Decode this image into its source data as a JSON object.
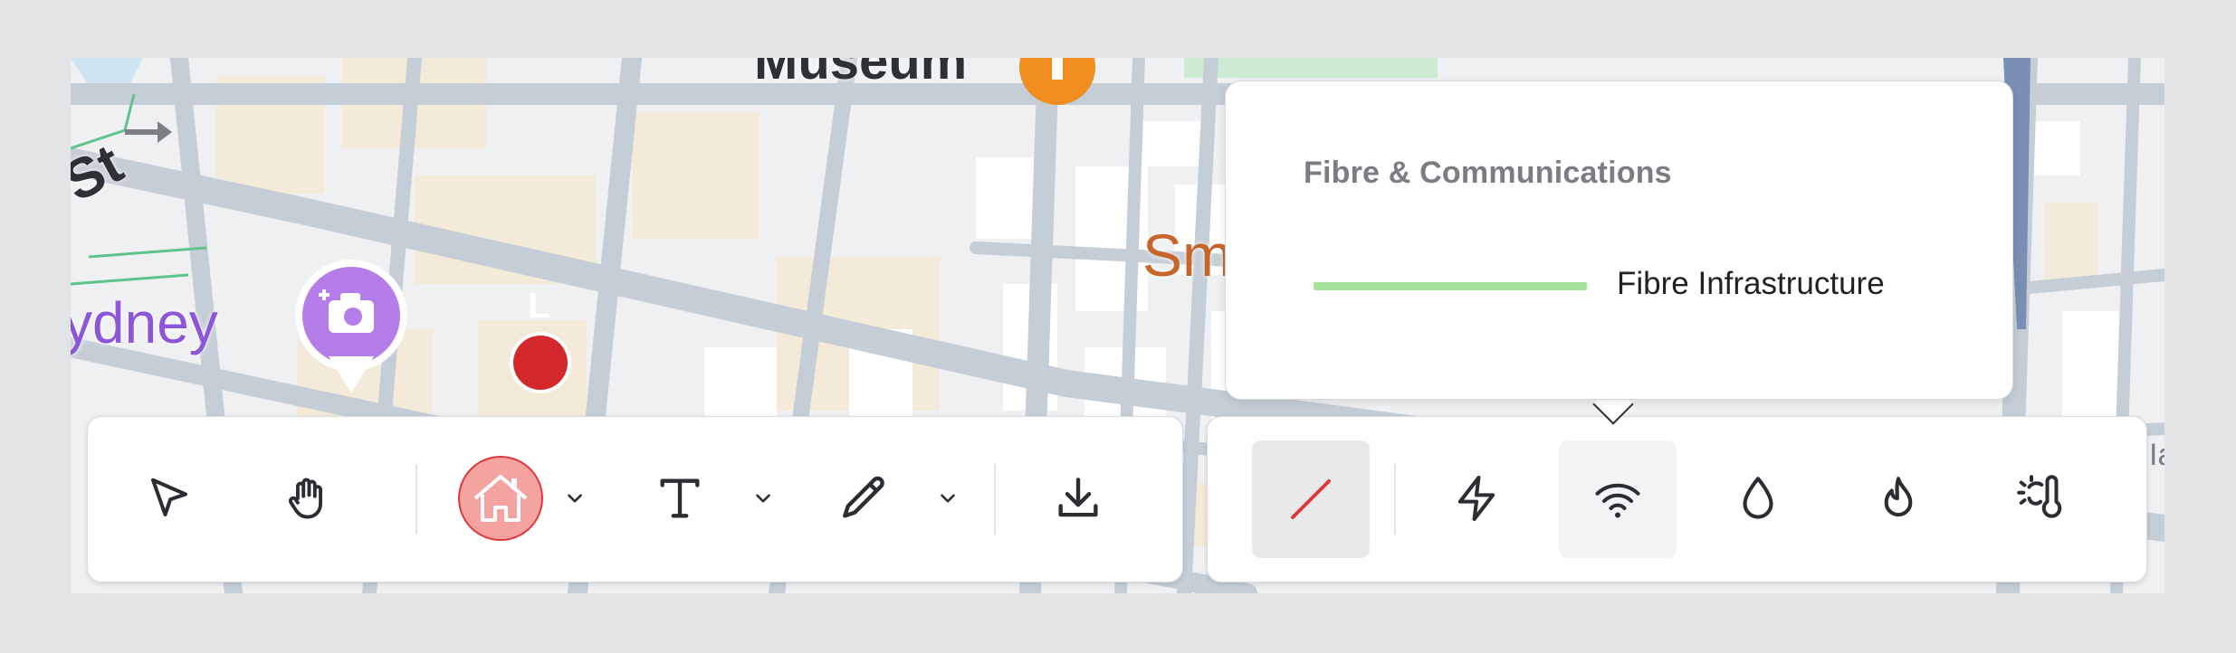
{
  "map": {
    "labels": {
      "street_fragment": "St",
      "place_fragment": "ydney",
      "museum_fragment": "Museum",
      "orange_fragment": "Sm",
      "marker_letter": "L",
      "bottom_fragment": "Ia"
    },
    "colors": {
      "road": "#c5cdd6",
      "block": "#f3ead9",
      "park": "#cdebd3",
      "purple_label": "#8c56d9",
      "orange_label": "#c7662a",
      "marker_red": "#d3292d",
      "museum_orange": "#ef8d1f"
    }
  },
  "toolbar_left": {
    "tools": [
      {
        "name": "select",
        "icon": "cursor-arrow-icon"
      },
      {
        "name": "pan",
        "icon": "hand-icon"
      },
      {
        "name": "place-marker",
        "icon": "house-icon",
        "has_dropdown": true
      },
      {
        "name": "text",
        "icon": "text-icon",
        "has_dropdown": true
      },
      {
        "name": "draw",
        "icon": "pencil-icon",
        "has_dropdown": true
      },
      {
        "name": "download",
        "icon": "download-icon"
      }
    ]
  },
  "toolbar_right": {
    "tools": [
      {
        "name": "line",
        "icon": "diagonal-line-icon",
        "selected": true
      },
      {
        "name": "electricity",
        "icon": "lightning-icon"
      },
      {
        "name": "fibre",
        "icon": "wifi-icon",
        "active": true
      },
      {
        "name": "water",
        "icon": "water-drop-icon"
      },
      {
        "name": "gas",
        "icon": "flame-icon"
      },
      {
        "name": "heat",
        "icon": "thermometer-sun-icon"
      }
    ]
  },
  "popover": {
    "heading": "Fibre & Communications",
    "items": [
      {
        "label": "Fibre Infrastructure",
        "color": "#a6e39a"
      }
    ]
  },
  "colors": {
    "accent_red": "#e0373b",
    "house_fill": "#f4a3a1",
    "selected_bg": "#e7e8ea",
    "active_bg": "#f2f3f4",
    "icon": "#2a2d31"
  }
}
